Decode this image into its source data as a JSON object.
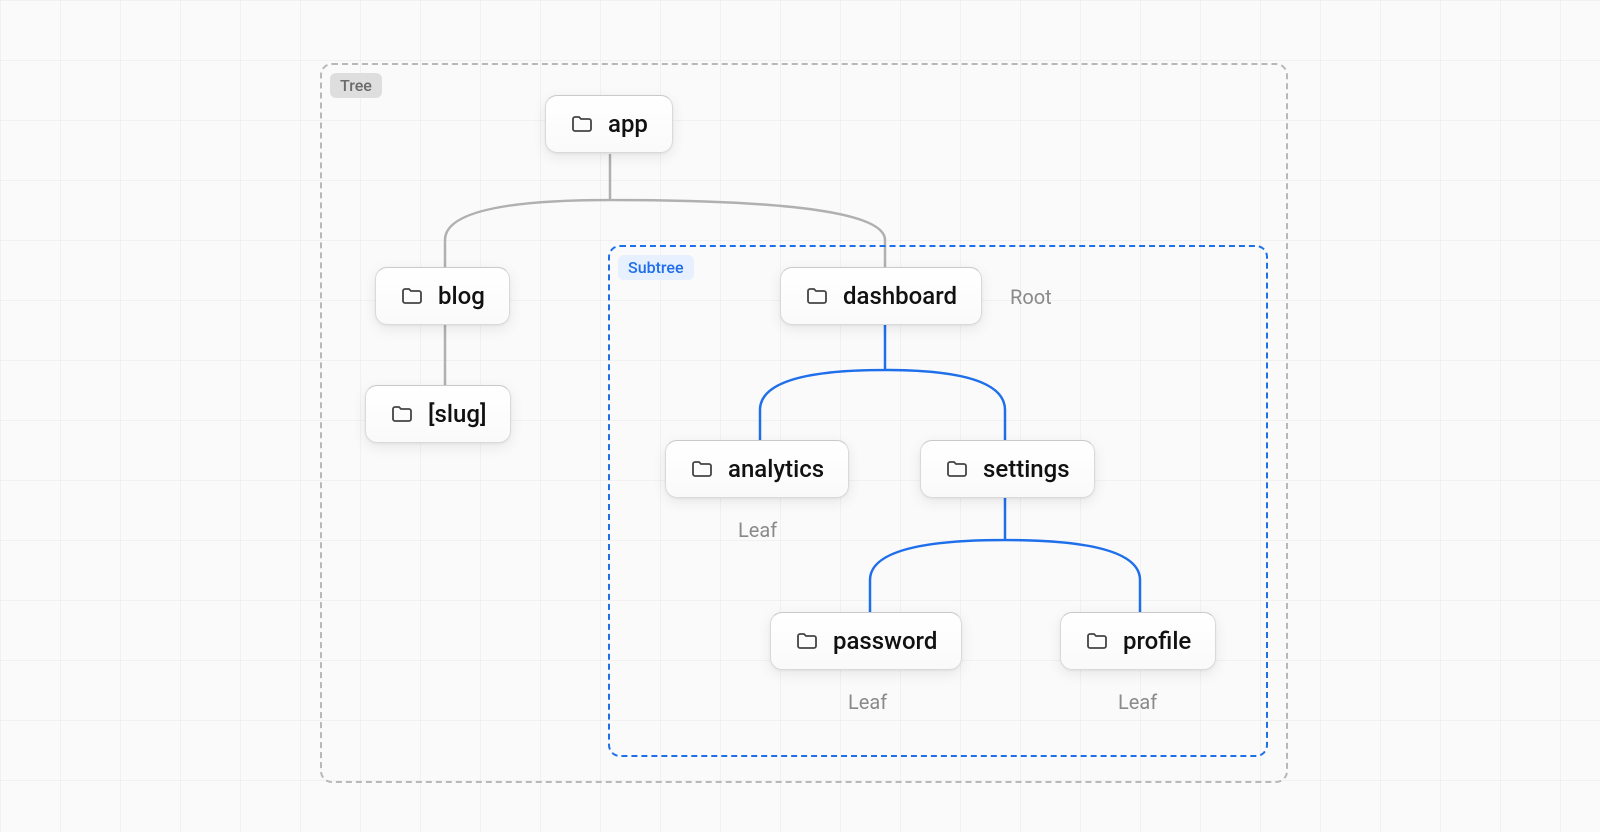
{
  "regions": {
    "tree_label": "Tree",
    "subtree_label": "Subtree"
  },
  "nodes": {
    "app": "app",
    "blog": "blog",
    "slug": "[slug]",
    "dashboard": "dashboard",
    "analytics": "analytics",
    "settings": "settings",
    "password": "password",
    "profile": "profile"
  },
  "annotations": {
    "root": "Root",
    "leaf_analytics": "Leaf",
    "leaf_password": "Leaf",
    "leaf_profile": "Leaf"
  },
  "colors": {
    "subtree_border": "#1f6feb",
    "tree_border": "#b8b8b8",
    "connector_gray": "#b0b0b0",
    "connector_blue": "#1f6feb"
  }
}
